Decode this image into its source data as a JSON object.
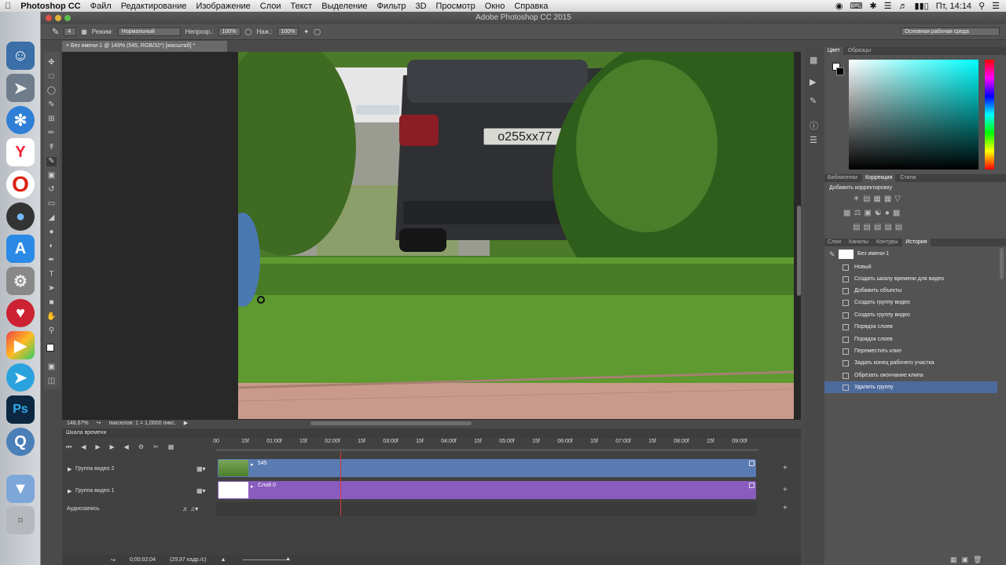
{
  "menubar": {
    "app": "Photoshop CC",
    "items": [
      "Файл",
      "Редактирование",
      "Изображение",
      "Слои",
      "Текст",
      "Выделение",
      "Фильтр",
      "3D",
      "Просмотр",
      "Окно",
      "Справка"
    ],
    "clock": "Пт, 14:14"
  },
  "window": {
    "title": "Adobe Photoshop CC 2015"
  },
  "options": {
    "brush_size": "4",
    "mode_label": "Режим:",
    "mode_value": "Нормальный",
    "opacity_label": "Непрозр.:",
    "opacity_value": "100%",
    "flow_label": "Наж.:",
    "flow_value": "100%",
    "workspace": "Основная рабочая среда"
  },
  "document": {
    "tab": "Без имени-1 @ 149% (545, RGB/32*) [масштаб] *",
    "zoom": "148,67%",
    "pixel_info": "пикселов: 1 = 1,0000 пикс."
  },
  "photo": {
    "plate": "о255хх77"
  },
  "color_panel": {
    "tabs": [
      "Цвет",
      "Образцы"
    ],
    "active": 0
  },
  "adjust_panel": {
    "tabs": [
      "Библиотеки",
      "Коррекция",
      "Стили"
    ],
    "active": 1,
    "caption": "Добавить корректировку"
  },
  "history_panel": {
    "tabs": [
      "Слои",
      "Каналы",
      "Контуры",
      "История"
    ],
    "active": 3,
    "snapshot": "Без имени-1",
    "items": [
      "Новый",
      "Создать шкалу времени для видео",
      "Добавить объекты",
      "Создать группу видео",
      "Создать группу видео",
      "Порядок слоев",
      "Порядок слоев",
      "Переместить клип",
      "Задать конец рабочего участка",
      "Обрезать окончание клипа",
      "Удалить группу"
    ],
    "selected_index": 10
  },
  "timeline": {
    "title": "Шкала времени",
    "ruler": [
      "00",
      "15f",
      "01:00f",
      "15f",
      "02:00f",
      "15f",
      "03:00f",
      "15f",
      "04:00f",
      "15f",
      "05:00f",
      "15f",
      "06:00f",
      "15f",
      "07:00f",
      "15f",
      "08:00f",
      "15f",
      "09:00f"
    ],
    "tracks": [
      {
        "name": "Группа видео 2",
        "clip": "545",
        "color": "#5a7bb1"
      },
      {
        "name": "Группа видео 1",
        "clip": "Слой 0",
        "color": "#8a5cbf"
      }
    ],
    "audio": "Аудиозапись",
    "timecode": "0;00;02;04",
    "fps": "(29,97 кадр./с)",
    "playhead_fraction": 0.229
  },
  "colors": {
    "selection": "#4d6a9c",
    "playhead": "#d23b3b"
  }
}
